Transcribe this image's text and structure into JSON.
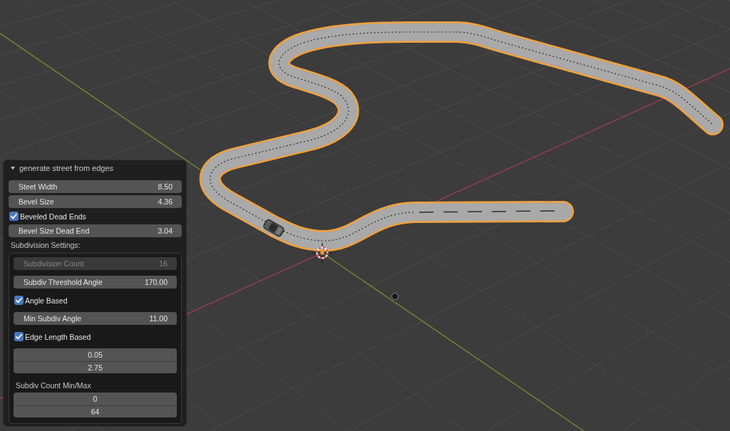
{
  "viewport": {
    "road": {
      "selected": true
    }
  },
  "operator_panel": {
    "title": "generate street from edges",
    "expanded": true,
    "items": [
      {
        "kind": "number",
        "label": "Steet Width",
        "value": "8.50",
        "disabled": false
      },
      {
        "kind": "number",
        "label": "Bevel Size",
        "value": "4.36",
        "disabled": false
      },
      {
        "kind": "checkbox",
        "label": "Beveled Dead Ends",
        "checked": true
      },
      {
        "kind": "number",
        "label": "Bevel Size Dead End",
        "value": "3.04",
        "disabled": false
      },
      {
        "kind": "heading",
        "label": "Subdivision Settings:"
      }
    ],
    "subdivision_box": {
      "items": [
        {
          "kind": "number",
          "label": "Subdivision Count",
          "value": "16",
          "disabled": true
        },
        {
          "kind": "number",
          "label": "Subdiv Threshold Angle",
          "value": "170.00",
          "disabled": false
        },
        {
          "kind": "checkbox",
          "label": "Angle Based",
          "checked": true
        },
        {
          "kind": "number",
          "label": "Min Subdiv Angle",
          "value": "11.00",
          "disabled": false
        },
        {
          "kind": "checkbox",
          "label": "Edge Length Based",
          "checked": true
        },
        {
          "kind": "column",
          "values": [
            "0.05",
            "2.75"
          ]
        },
        {
          "kind": "heading",
          "label": "Subdiv Count Min/Max"
        },
        {
          "kind": "column",
          "values": [
            "0",
            "64"
          ]
        }
      ]
    }
  }
}
